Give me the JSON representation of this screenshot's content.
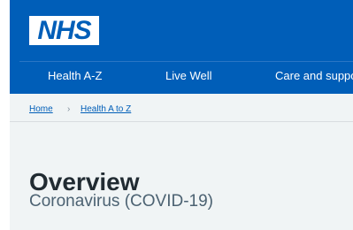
{
  "brand": {
    "logo_text": "NHS",
    "primary_color": "#005eb8"
  },
  "navigation": {
    "items": [
      {
        "label": "Health A-Z"
      },
      {
        "label": "Live Well"
      },
      {
        "label": "Care and support"
      }
    ]
  },
  "breadcrumb": {
    "items": [
      {
        "label": "Home"
      },
      {
        "label": "Health A to Z"
      }
    ],
    "separator": "›"
  },
  "page": {
    "title": "Overview",
    "subtitle": "Coronavirus (COVID-19)"
  }
}
